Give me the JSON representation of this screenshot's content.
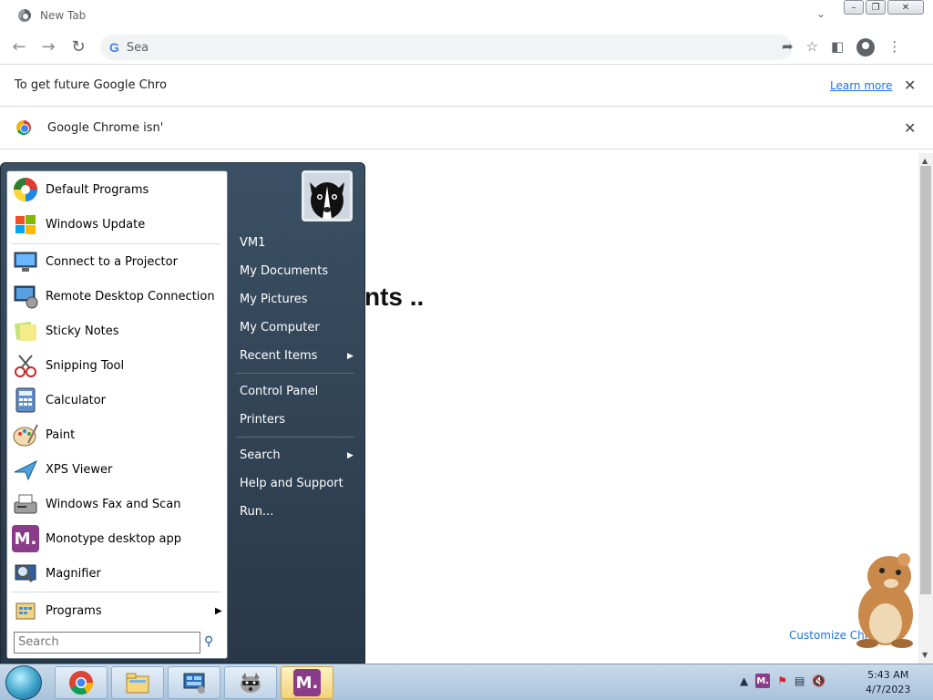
{
  "browser": {
    "tab_title": "New Tab",
    "omnibox_text": "Sea",
    "infobar1_text": "To get future Google Chro",
    "infobar1_link": "Learn more",
    "infobar2_text": "Google Chrome isn'",
    "page_text": "nts ..",
    "customize_link": "Customize Chr"
  },
  "start_menu": {
    "programs": [
      {
        "label": "Default Programs",
        "icon": "default-programs-icon"
      },
      {
        "label": "Windows Update",
        "icon": "windows-update-icon"
      },
      {
        "label": "Connect to a Projector",
        "icon": "projector-icon"
      },
      {
        "label": "Remote Desktop Connection",
        "icon": "remote-desktop-icon"
      },
      {
        "label": "Sticky Notes",
        "icon": "sticky-notes-icon"
      },
      {
        "label": "Snipping Tool",
        "icon": "snipping-tool-icon"
      },
      {
        "label": "Calculator",
        "icon": "calculator-icon"
      },
      {
        "label": "Paint",
        "icon": "paint-icon"
      },
      {
        "label": "XPS Viewer",
        "icon": "xps-viewer-icon"
      },
      {
        "label": "Windows Fax and Scan",
        "icon": "fax-scan-icon"
      },
      {
        "label": "Monotype desktop app",
        "icon": "monotype-icon"
      },
      {
        "label": "Magnifier",
        "icon": "magnifier-icon"
      }
    ],
    "all_programs_label": "Programs",
    "search_placeholder": "Search",
    "right_items": [
      {
        "label": "VM1"
      },
      {
        "label": "My Documents"
      },
      {
        "label": "My Pictures"
      },
      {
        "label": "My Computer"
      },
      {
        "label": "Recent Items"
      },
      {
        "label": "Control Panel"
      },
      {
        "label": "Printers"
      },
      {
        "label": "Search"
      },
      {
        "label": "Help and Support"
      },
      {
        "label": "Run..."
      }
    ]
  },
  "taskbar": {
    "monotype_letter": "M.",
    "clock_time": "5:43 AM",
    "clock_date": "4/7/2023"
  }
}
